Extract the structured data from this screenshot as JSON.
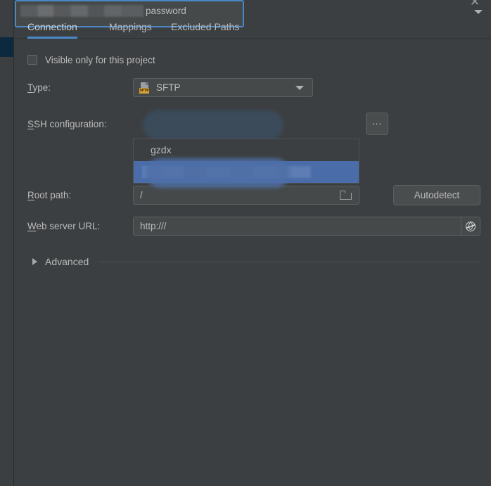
{
  "window": {
    "close_icon": "close-icon",
    "close_glyph": "✕"
  },
  "sidebar": {
    "selected_marker": ""
  },
  "tabs": [
    {
      "label": "Connection",
      "active": true
    },
    {
      "label": "Mappings",
      "active": false
    },
    {
      "label": "Excluded Paths",
      "active": false
    }
  ],
  "form": {
    "visible_only_checkbox": {
      "label": "Visible only for this project",
      "checked": false
    },
    "type": {
      "label_mnemonic": "T",
      "label_rest": "ype:",
      "value": "SFTP",
      "icon": "sftp-file-icon",
      "icon_badge": "SFTP"
    },
    "ssh_configuration": {
      "label_mnemonic": "S",
      "label_rest": "SH configuration:",
      "value_redacted": true,
      "value_suffix": "password",
      "browse_button_label": "...",
      "dropdown_open": true,
      "options": [
        {
          "label": "gzdx",
          "selected": false,
          "redacted": false
        },
        {
          "label": "",
          "selected": true,
          "redacted": true
        }
      ]
    },
    "root_path": {
      "label_mnemonic": "R",
      "label_rest": "oot path:",
      "value": "/",
      "folder_icon": "folder-icon",
      "autodetect_label": "Autodetect"
    },
    "web_server_url": {
      "label_mnemonic": "W",
      "label_rest": "eb server URL:",
      "value": "http:///",
      "globe_icon": "globe-icon"
    },
    "advanced": {
      "label": "Advanced",
      "expanded": false,
      "triangle_icon": "triangle-right-icon"
    }
  },
  "colors": {
    "background": "#3c3f41",
    "field_background": "#45494a",
    "accent_blue": "#4a88c7",
    "selection_blue": "#4a6ca8",
    "text": "#bbbbbb",
    "sftp_badge": "#d9a23a"
  }
}
